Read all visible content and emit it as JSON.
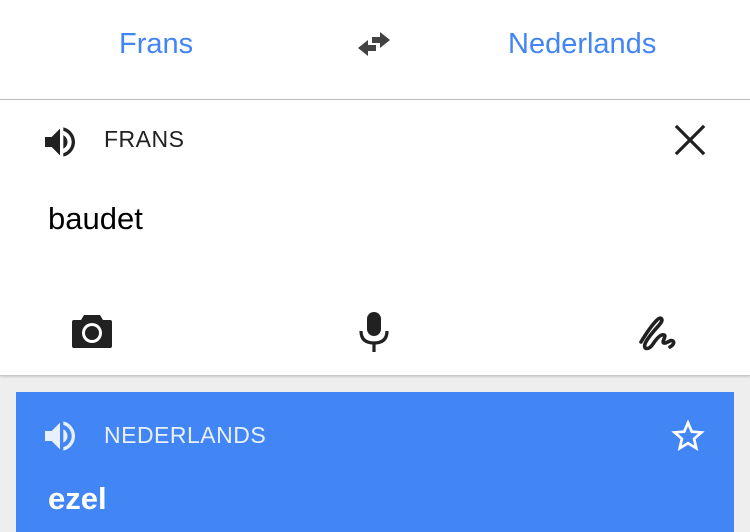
{
  "top_bar": {
    "source_language": "Frans",
    "target_language": "Nederlands",
    "swap_icon": "swap-horiz-icon"
  },
  "input_card": {
    "language_label": "FRANS",
    "text": "baudet",
    "icons": {
      "speaker": "volume-up-icon",
      "clear": "close-icon",
      "camera": "camera-icon",
      "mic": "mic-icon",
      "handwriting": "handwriting-icon"
    }
  },
  "output_card": {
    "language_label": "NEDERLANDS",
    "text": "ezel",
    "icons": {
      "speaker": "volume-up-icon",
      "star": "star-outline-icon"
    }
  },
  "colors": {
    "accent": "#4285f4",
    "icon_dark": "#212121",
    "background": "#eeeeee"
  }
}
